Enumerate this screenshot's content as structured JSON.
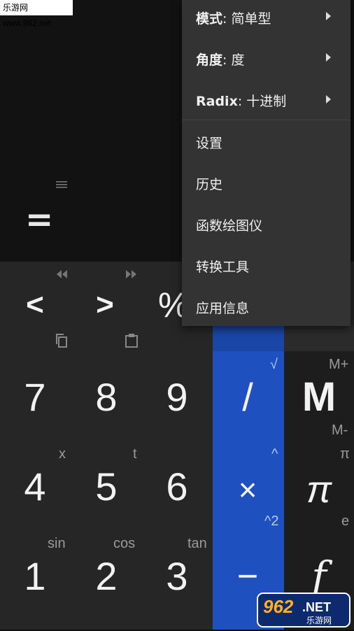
{
  "watermark": "乐游网 www.962.net",
  "display": {
    "equals": "="
  },
  "nav": {
    "back": "<",
    "forward": ">",
    "percent": "%"
  },
  "digits": {
    "d7": "7",
    "d8": "8",
    "d9": "9",
    "d4": "4",
    "d5": "5",
    "d6": "6",
    "d1": "1",
    "d2": "2",
    "d3": "3"
  },
  "sub_labels": {
    "x": "x",
    "t": "t",
    "sin": "sin",
    "cos": "cos",
    "tan": "tan"
  },
  "operators": {
    "divide": "/",
    "multiply": "×",
    "minus": "−",
    "sqrt": "√",
    "power": "^",
    "square": "^2"
  },
  "right_col": {
    "memory": "M",
    "mplus": "M+",
    "mminus": "M-",
    "pi": "π",
    "pi_sub": "π",
    "f": "f",
    "e_sub": "e"
  },
  "menu": {
    "mode_label": "模式",
    "mode_value": ": 简单型",
    "angle_label": "角度",
    "angle_value": ": 度",
    "radix_label": "Radix",
    "radix_value": ": 十进制",
    "settings": "设置",
    "history": "历史",
    "graph": "函数绘图仪",
    "converter": "转换工具",
    "about": "应用信息"
  },
  "logo": {
    "number": "962",
    "suffix": ".NET",
    "subtitle": "乐游网"
  },
  "colors": {
    "operator_column": "#1e50c0",
    "menu_bg": "#333333",
    "keypad_bg": "#262626"
  }
}
